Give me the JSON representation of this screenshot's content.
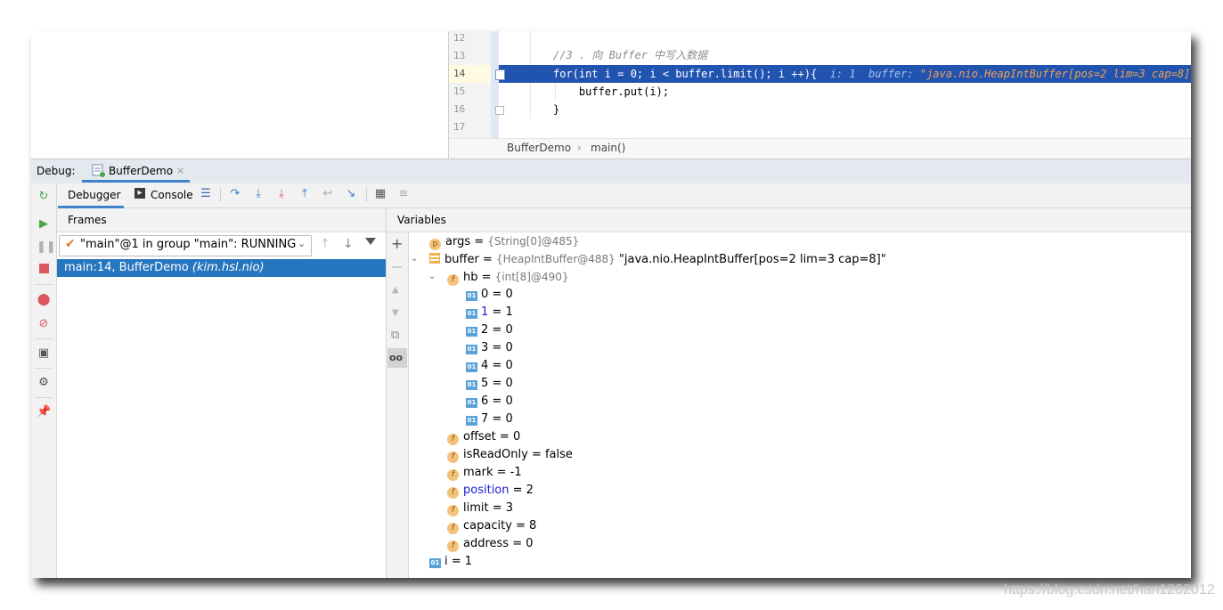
{
  "editor": {
    "lines": [
      {
        "num": "12",
        "code": ""
      },
      {
        "num": "13",
        "code": "//3 . 向 Buffer 中写入数据"
      },
      {
        "num": "14",
        "code": "for(int i = 0; i < buffer.limit(); i ++){"
      },
      {
        "num": "15",
        "code": "    buffer.put(i);"
      },
      {
        "num": "16",
        "code": "}"
      },
      {
        "num": "17",
        "code": ""
      }
    ],
    "inline_debug_i": "i: 1",
    "inline_debug_buffer_label": "buffer:",
    "inline_debug_buffer_value": "\"java.nio.HeapIntBuffer[pos=2 lim=3 cap=8]\"",
    "breadcrumb": [
      "BufferDemo",
      "main()"
    ],
    "breadcrumb_sep": "›"
  },
  "debug": {
    "label": "Debug:",
    "tab_title": "BufferDemo",
    "tab_close": "×"
  },
  "toolbar": {
    "debugger_tab": "Debugger",
    "console_tab": "Console"
  },
  "frames": {
    "title": "Frames",
    "thread": "\"main\"@1 in group \"main\": RUNNING",
    "selected_frame": "main:14, BufferDemo",
    "selected_frame_pkg": "(kim.hsl.nio)"
  },
  "variables": {
    "title": "Variables",
    "args": {
      "name": "args",
      "eq": " = ",
      "type": "{String[0]@485}"
    },
    "buffer": {
      "name": "buffer",
      "eq": " = ",
      "type": "{HeapIntBuffer@488}",
      "value": " \"java.nio.HeapIntBuffer[pos=2 lim=3 cap=8]\""
    },
    "hb": {
      "name": "hb",
      "eq": " = ",
      "type": "{int[8]@490}"
    },
    "hb_items": [
      {
        "index": "0",
        "value": " = 0",
        "blue": false
      },
      {
        "index": "1",
        "value": " = 1",
        "blue": true
      },
      {
        "index": "2",
        "value": " = 0",
        "blue": false
      },
      {
        "index": "3",
        "value": " = 0",
        "blue": false
      },
      {
        "index": "4",
        "value": " = 0",
        "blue": false
      },
      {
        "index": "5",
        "value": " = 0",
        "blue": false
      },
      {
        "index": "6",
        "value": " = 0",
        "blue": false
      },
      {
        "index": "7",
        "value": " = 0",
        "blue": false
      }
    ],
    "fields": [
      {
        "name": "offset",
        "value": " = 0",
        "blue": false
      },
      {
        "name": "isReadOnly",
        "value": " = false",
        "blue": false
      },
      {
        "name": "mark",
        "value": " = -1",
        "blue": false
      },
      {
        "name": "position",
        "value": " = 2",
        "blue": true
      },
      {
        "name": "limit",
        "value": " = 3",
        "blue": false
      },
      {
        "name": "capacity",
        "value": " = 8",
        "blue": false
      },
      {
        "name": "address",
        "value": " = 0",
        "blue": false
      }
    ],
    "i": {
      "name": "i",
      "value": " = 1"
    }
  },
  "watermark": "https://blog.csdn.net/han1202012",
  "colors": {
    "selection": "#2154b1",
    "frame_selection": "#2675bf",
    "accent": "#4083c9"
  }
}
